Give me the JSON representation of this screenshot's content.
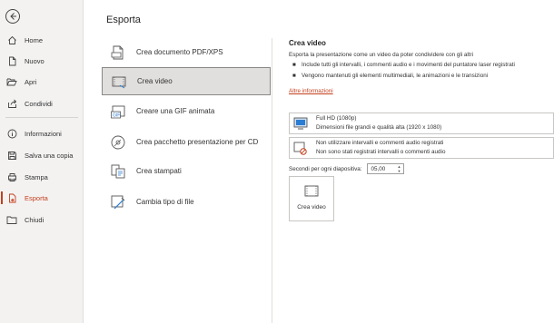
{
  "nav": {
    "items": [
      {
        "label": "Home"
      },
      {
        "label": "Nuovo"
      },
      {
        "label": "Apri"
      },
      {
        "label": "Condividi"
      },
      {
        "label": "Informazioni"
      },
      {
        "label": "Salva una copia"
      },
      {
        "label": "Stampa"
      },
      {
        "label": "Esporta"
      },
      {
        "label": "Chiudi"
      }
    ]
  },
  "page": {
    "title": "Esporta"
  },
  "options": [
    {
      "label": "Crea documento PDF/XPS"
    },
    {
      "label": "Crea video"
    },
    {
      "label": "Creare una GIF animata"
    },
    {
      "label": "Crea pacchetto presentazione per CD"
    },
    {
      "label": "Crea stampati"
    },
    {
      "label": "Cambia tipo di file"
    }
  ],
  "detail": {
    "title": "Crea video",
    "description": "Esporta la presentazione come un video da poter condividere con gli altri",
    "bullets": [
      "Include tutti gli intervalli, i commenti audio e i movimenti del puntatore laser registrati",
      "Vengono mantenuti gli elementi multimediali, le animazioni e le transizioni"
    ],
    "link": "Altre informazioni",
    "quality": {
      "line1": "Full HD (1080p)",
      "line2": "Dimensioni file grandi e qualità alta (1920 x 1080)"
    },
    "timing": {
      "line1": "Non utilizzare intervalli e commenti audio registrati",
      "line2": "Non sono stati registrati intervalli o commenti audio"
    },
    "seconds_label": "Secondi per ogni diapositiva:",
    "seconds_value": "05,00",
    "create_button": "Crea video"
  },
  "colors": {
    "accent": "#c43e1c",
    "nav_bg": "#f3f2f1",
    "selected_bg": "#e1dfdd"
  }
}
